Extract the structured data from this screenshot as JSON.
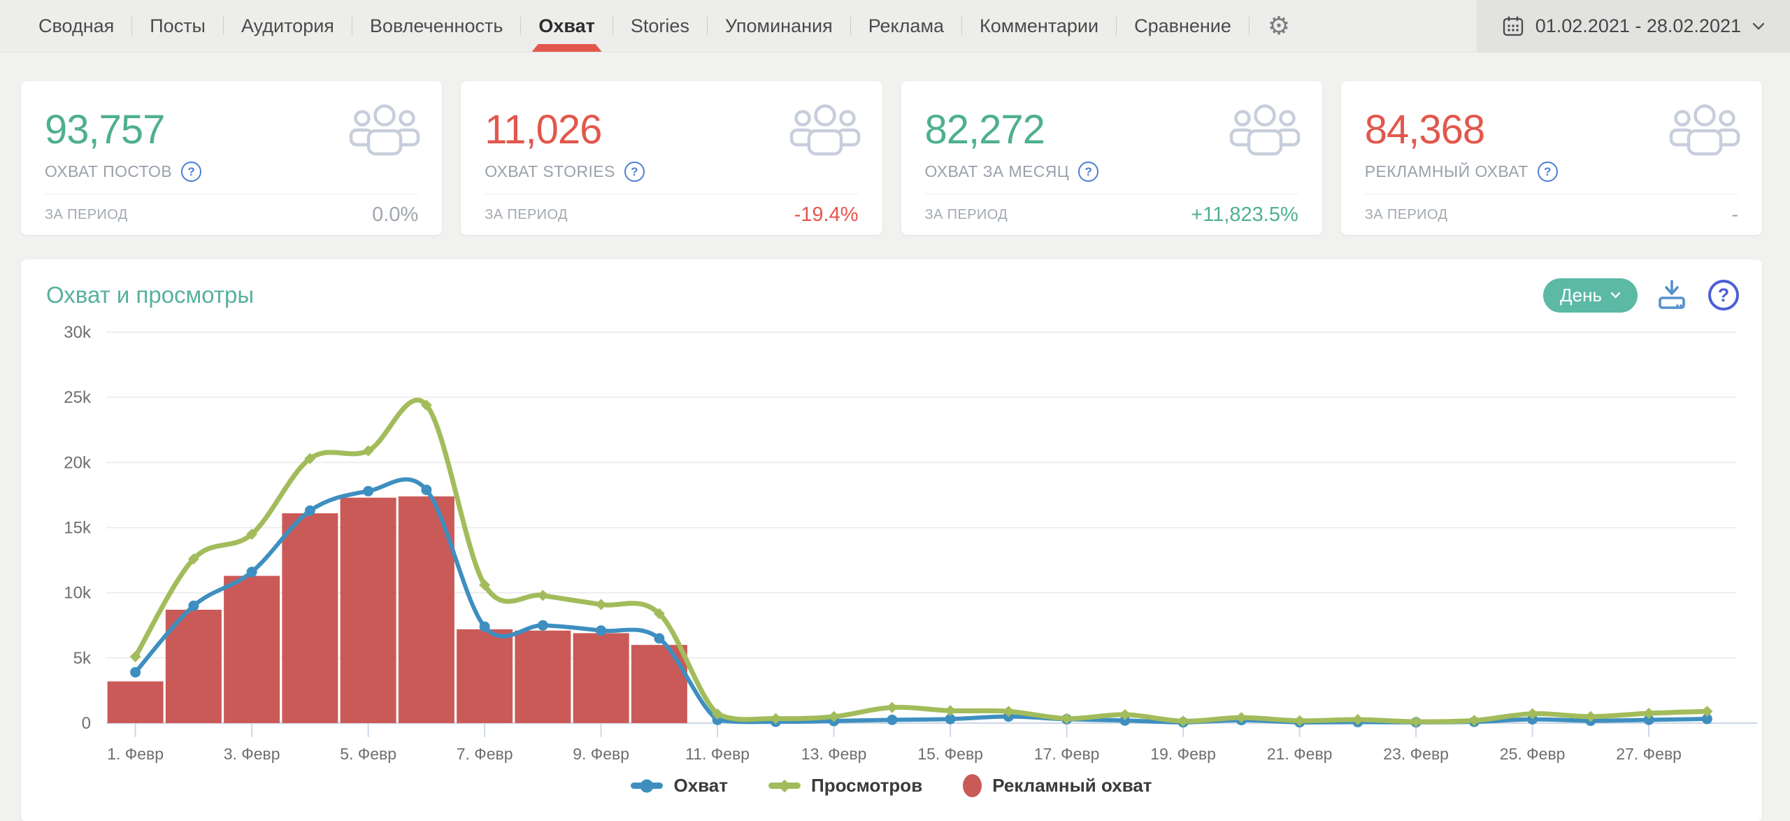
{
  "nav": {
    "items": [
      {
        "label": "Сводная",
        "active": false
      },
      {
        "label": "Посты",
        "active": false
      },
      {
        "label": "Аудитория",
        "active": false
      },
      {
        "label": "Вовлеченность",
        "active": false
      },
      {
        "label": "Охват",
        "active": true
      },
      {
        "label": "Stories",
        "active": false
      },
      {
        "label": "Упоминания",
        "active": false
      },
      {
        "label": "Реклама",
        "active": false
      },
      {
        "label": "Комментарии",
        "active": false
      },
      {
        "label": "Сравнение",
        "active": false
      }
    ],
    "settings_icon": "gear-icon",
    "date_range": "01.02.2021 - 28.02.2021",
    "active_underline_color": "#e2574c"
  },
  "cards": [
    {
      "value": "93,757",
      "label": "ОХВАТ ПОСТОВ",
      "period_label": "ЗА ПЕРИОД",
      "delta": "0.0%",
      "value_color": "#4fb08c",
      "delta_color": "#a0a6ae"
    },
    {
      "value": "11,026",
      "label": "ОХВАТ STORIES",
      "period_label": "ЗА ПЕРИОД",
      "delta": "-19.4%",
      "value_color": "#e2574c",
      "delta_color": "#e2574c"
    },
    {
      "value": "82,272",
      "label": "ОХВАТ ЗА МЕСЯЦ",
      "period_label": "ЗА ПЕРИОД",
      "delta": "+11,823.5%",
      "value_color": "#4fb08c",
      "delta_color": "#4fb08c"
    },
    {
      "value": "84,368",
      "label": "РЕКЛАМНЫЙ ОХВАТ",
      "period_label": "ЗА ПЕРИОД",
      "delta": "-",
      "value_color": "#e2574c",
      "delta_color": "#a0a6ae"
    }
  ],
  "chart_panel": {
    "title": "Охват и просмотры",
    "title_color": "#56b19b",
    "interval_button_label": "День",
    "interval_button_color": "#5bb9a6",
    "download_icon_color": "#5590cc",
    "help_icon_color": "#4b5fd6"
  },
  "chart_data": {
    "type": "mixed",
    "title": "Охват и просмотры",
    "days": 28,
    "month_label": "Февр",
    "ylim": [
      0,
      30000
    ],
    "grid": true,
    "grid_color": "#e9e9e9",
    "axis_color": "#ccd7e6",
    "tick_label_color": "#6f6f6f",
    "legend_position": "bottom",
    "yticks": [
      {
        "value": 0,
        "label": "0"
      },
      {
        "value": 5000,
        "label": "5k"
      },
      {
        "value": 10000,
        "label": "10k"
      },
      {
        "value": 15000,
        "label": "15k"
      },
      {
        "value": 20000,
        "label": "20k"
      },
      {
        "value": 25000,
        "label": "25k"
      },
      {
        "value": 30000,
        "label": "30k"
      }
    ],
    "xticks": [
      {
        "day": 1,
        "label": "1. Февр"
      },
      {
        "day": 3,
        "label": "3. Февр"
      },
      {
        "day": 5,
        "label": "5. Февр"
      },
      {
        "day": 7,
        "label": "7. Февр"
      },
      {
        "day": 9,
        "label": "9. Февр"
      },
      {
        "day": 11,
        "label": "11. Февр"
      },
      {
        "day": 13,
        "label": "13. Февр"
      },
      {
        "day": 15,
        "label": "15. Февр"
      },
      {
        "day": 17,
        "label": "17. Февр"
      },
      {
        "day": 19,
        "label": "19. Февр"
      },
      {
        "day": 21,
        "label": "21. Февр"
      },
      {
        "day": 23,
        "label": "23. Февр"
      },
      {
        "day": 25,
        "label": "25. Февр"
      },
      {
        "day": 27,
        "label": "27. Февр"
      }
    ],
    "series": [
      {
        "name": "Охват",
        "type": "line",
        "marker": "circle",
        "color": "#3e8fc0",
        "values": [
          3900,
          9000,
          11600,
          16300,
          17800,
          17900,
          7400,
          7500,
          7100,
          6500,
          250,
          100,
          160,
          250,
          310,
          500,
          300,
          200,
          60,
          230,
          60,
          80,
          60,
          100,
          290,
          180,
          250,
          320
        ]
      },
      {
        "name": "Просмотров",
        "type": "line",
        "marker": "diamond",
        "color": "#a2bc5b",
        "values": [
          5100,
          12600,
          14500,
          20300,
          20900,
          24400,
          10600,
          9800,
          9100,
          8400,
          700,
          350,
          500,
          1200,
          950,
          900,
          350,
          650,
          150,
          420,
          180,
          270,
          110,
          200,
          720,
          500,
          750,
          900
        ]
      },
      {
        "name": "Рекламный охват",
        "type": "bar",
        "color": "#ca5a58",
        "values": [
          3200,
          8700,
          11300,
          16100,
          17300,
          17400,
          7200,
          7100,
          6900,
          6000,
          0,
          0,
          0,
          0,
          0,
          0,
          0,
          0,
          0,
          0,
          0,
          0,
          0,
          0,
          0,
          0,
          0,
          0
        ]
      }
    ]
  }
}
